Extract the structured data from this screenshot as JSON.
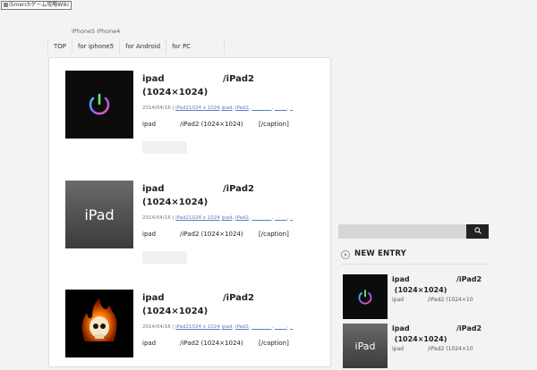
{
  "header": {
    "logo_text": "iSmerchゲーム攻略Wiki",
    "tagline": "iPhone5 iPhone4"
  },
  "nav": {
    "items": [
      "TOP",
      "for iphone5",
      "for Android",
      "for PC"
    ]
  },
  "posts": [
    {
      "thumb": "power-icon",
      "title_a": "ipad",
      "title_b": "/iPad2",
      "title_c": "(1024×1024)",
      "date": "2014/04/16 |",
      "cat": "iPad21024 x 1024",
      "tags": [
        "ipad",
        "iPad2",
        "________",
        "_____",
        "_"
      ],
      "excerpt_a": "ipad",
      "excerpt_b": "/iPad2  (1024×1024)",
      "excerpt_c": "[/caption]"
    },
    {
      "thumb": "ipad-text",
      "thumb_text": "iPad",
      "title_a": "ipad",
      "title_b": "/iPad2",
      "title_c": "(1024×1024)",
      "date": "2014/04/16 |",
      "cat": "iPad21024 x 1024",
      "tags": [
        "ipad",
        "iPad2",
        "________",
        "_____",
        "_"
      ],
      "excerpt_a": "ipad",
      "excerpt_b": "/iPad2  (1024×1024)",
      "excerpt_c": "[/caption]"
    },
    {
      "thumb": "flaming-skull",
      "title_a": "ipad",
      "title_b": "/iPad2",
      "title_c": "(1024×1024)",
      "date": "2014/04/16 |",
      "cat": "iPad21024 x 1024",
      "tags": [
        "ipad",
        "iPad2",
        "________",
        "_____",
        "_"
      ],
      "excerpt_a": "ipad",
      "excerpt_b": "/iPad2  (1024×1024)",
      "excerpt_c": "[/caption]"
    }
  ],
  "sidebar": {
    "search_placeholder": "",
    "search_icon": "magnifier-icon",
    "new_entry_title": "NEW ENTRY",
    "entries": [
      {
        "thumb": "power-icon",
        "title_a": "ipad",
        "title_b": "/iPad2",
        "title_c": "(1024×1024)",
        "ex_a": "ipad",
        "ex_b": "/iPad2  (1024×10"
      },
      {
        "thumb": "ipad-text",
        "thumb_text": "iPad",
        "title_a": "ipad",
        "title_b": "/iPad2",
        "title_c": "(1024×1024)",
        "ex_a": "ipad",
        "ex_b": "/iPad2  (1024×10"
      }
    ]
  },
  "colors": {
    "link": "#5b7fc0",
    "search_button": "#222222"
  }
}
